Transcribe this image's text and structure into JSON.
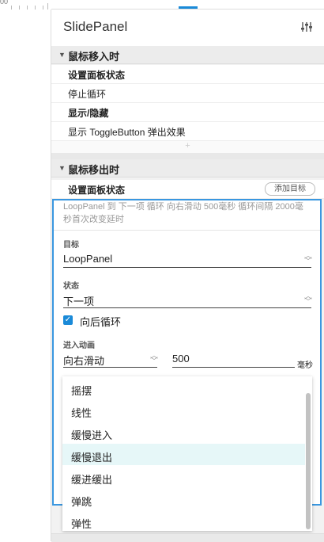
{
  "ruler": {
    "origin_label": "00"
  },
  "panel": {
    "title": "SlidePanel",
    "settings_icon": "sliders-icon"
  },
  "mouse_enter": {
    "label": "鼠标移入时",
    "actions": [
      {
        "text": "设置面板状态",
        "bold": true
      },
      {
        "text": "停止循环",
        "bold": false
      },
      {
        "text": "显示/隐藏",
        "bold": true
      },
      {
        "text": "显示 ToggleButton 弹出效果",
        "bold": false
      }
    ],
    "add_symbol": "+"
  },
  "mouse_leave": {
    "label": "鼠标移出时",
    "action": "设置面板状态",
    "add_target_button": "添加目标"
  },
  "editor": {
    "summary": "LoopPanel 到 下一项 循环 向右滑动 500毫秒 循环间隔 2000毫秒首次改变延时",
    "target_label": "目标",
    "target_value": "LoopPanel",
    "state_label": "状态",
    "state_value": "下一项",
    "loop_checkbox_label": "向后循环",
    "loop_checked": true,
    "anim_label": "进入动画",
    "anim_value": "向右滑动",
    "duration_value": "500",
    "duration_unit": "毫秒"
  },
  "dropdown": {
    "options": [
      "摇摆",
      "线性",
      "缓慢进入",
      "缓慢退出",
      "缓进缓出",
      "弹跳",
      "弹性"
    ],
    "highlighted_index": 3
  },
  "colors": {
    "accent": "#1a8ad8",
    "editor_border": "#3a97e0",
    "highlight": "#e6f7f8"
  }
}
